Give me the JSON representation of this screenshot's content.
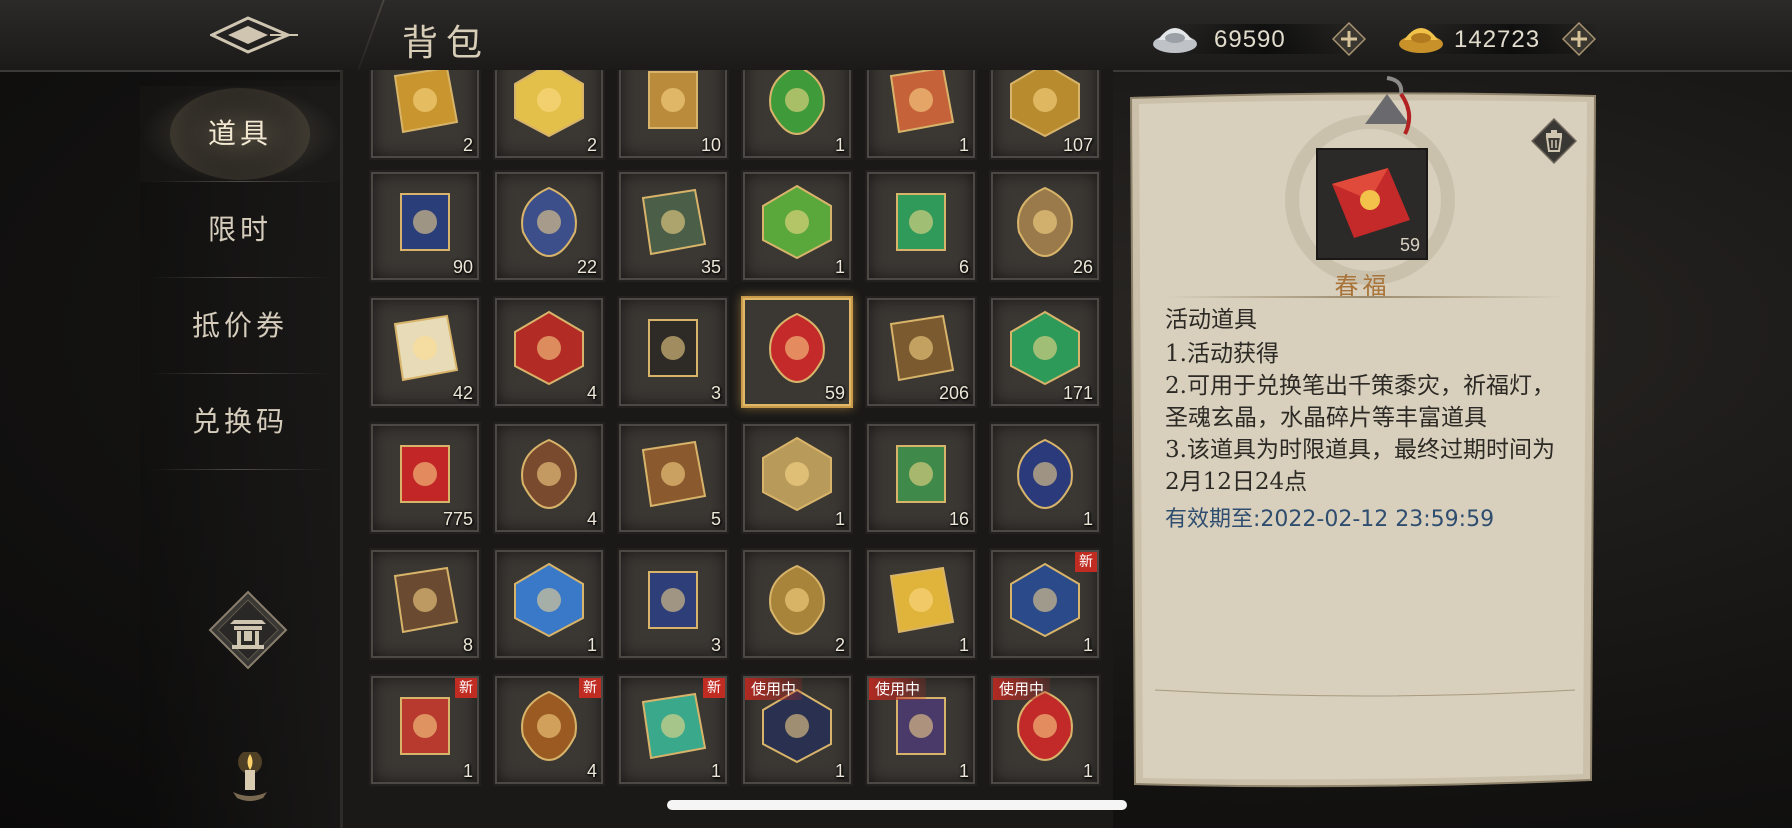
{
  "header": {
    "title": "背包",
    "silver_amount": "69590",
    "gold_amount": "142723"
  },
  "sidebar": {
    "items": [
      {
        "label": "道具",
        "active": true
      },
      {
        "label": "限时",
        "active": false
      },
      {
        "label": "抵价券",
        "active": false
      },
      {
        "label": "兑换码",
        "active": false
      }
    ]
  },
  "grid": {
    "cells": [
      {
        "count": "2",
        "icon": "gold-plaque-icon",
        "color": "#c8952e"
      },
      {
        "count": "2",
        "icon": "lantern-icon",
        "color": "#e3c04a"
      },
      {
        "count": "10",
        "icon": "merit-badge-icon",
        "color": "#b98b3a"
      },
      {
        "count": "1",
        "icon": "green-token-icon",
        "color": "#3f9a3a"
      },
      {
        "count": "1",
        "icon": "scroll-icon",
        "color": "#c6623a"
      },
      {
        "count": "107",
        "icon": "jade-seal-icon",
        "color": "#b88b2e"
      },
      {
        "count": "90",
        "icon": "puzzle-piece-icon",
        "color": "#2a3e7a"
      },
      {
        "count": "22",
        "icon": "dragon-card-icon",
        "color": "#3c4f8a"
      },
      {
        "count": "35",
        "icon": "beast-card-icon",
        "color": "#4a5e48"
      },
      {
        "count": "1",
        "icon": "hero-portrait-icon",
        "color": "#5aa83c"
      },
      {
        "count": "6",
        "icon": "pearl-pedestal-icon",
        "color": "#2f9a5a"
      },
      {
        "count": "26",
        "icon": "merit-badge-icon",
        "color": "#9a7a4a"
      },
      {
        "count": "42",
        "icon": "treasure-ticket-icon",
        "color": "#e8dcb8"
      },
      {
        "count": "4",
        "icon": "red-pouch-icon",
        "color": "#b22b25"
      },
      {
        "count": "3",
        "icon": "black-pouch-icon",
        "color": "#2e2a26"
      },
      {
        "count": "59",
        "icon": "red-envelope-icon",
        "color": "#c42a2a",
        "selected": true
      },
      {
        "count": "206",
        "icon": "points-medal-icon",
        "color": "#7a5a2e"
      },
      {
        "count": "171",
        "icon": "jade-knot-icon",
        "color": "#2e9a5a"
      },
      {
        "count": "775",
        "icon": "red-flower-icon",
        "color": "#c22626"
      },
      {
        "count": "4",
        "icon": "dragon-card-icon",
        "color": "#7a4a2e"
      },
      {
        "count": "5",
        "icon": "sword-card-icon",
        "color": "#8a5a2e"
      },
      {
        "count": "1",
        "icon": "portrait-card-icon",
        "color": "#b89a5a"
      },
      {
        "count": "16",
        "icon": "treasure-chest-icon",
        "color": "#3f8a4a"
      },
      {
        "count": "1",
        "icon": "new-year-card-icon",
        "color": "#2a3a7a"
      },
      {
        "count": "8",
        "icon": "trident-card-icon",
        "color": "#6a4a30"
      },
      {
        "count": "1",
        "icon": "hero-portrait-icon",
        "color": "#3a78c8"
      },
      {
        "count": "3",
        "icon": "trident-card-icon",
        "color": "#2e3e78"
      },
      {
        "count": "2",
        "icon": "merit-badge-icon",
        "color": "#a8843a"
      },
      {
        "count": "1",
        "icon": "gold-feather-icon",
        "color": "#e0b43a"
      },
      {
        "count": "1",
        "icon": "card-box-icon",
        "color": "#2a4a8a",
        "badge": "新"
      },
      {
        "count": "1",
        "icon": "card-box-icon",
        "color": "#b83a2e",
        "badge": "新"
      },
      {
        "count": "4",
        "icon": "wood-chest-icon",
        "color": "#9a5a22",
        "badge": "新"
      },
      {
        "count": "1",
        "icon": "dragon-seal-icon",
        "color": "#3aa88a",
        "badge": "新"
      },
      {
        "count": "1",
        "icon": "moon-frame-icon",
        "color": "#2a3050",
        "status": "使用中"
      },
      {
        "count": "1",
        "icon": "emote-pack-icon",
        "color": "#4a3a6a",
        "status": "使用中"
      },
      {
        "count": "1",
        "icon": "vip-card-icon",
        "color": "#c22a2a",
        "status": "使用中"
      }
    ]
  },
  "detail": {
    "name": "春福",
    "count": "59",
    "type": "活动道具",
    "lines": [
      "1.活动获得",
      "2.可用于兑换笔出千策黍灾，祈福灯，圣魂玄晶，水晶碎片等丰富道具",
      "3.该道具为时限道具，最终过期时间为2月12日24点"
    ],
    "expiry": "有效期至:2022-02-12 23:59:59"
  }
}
